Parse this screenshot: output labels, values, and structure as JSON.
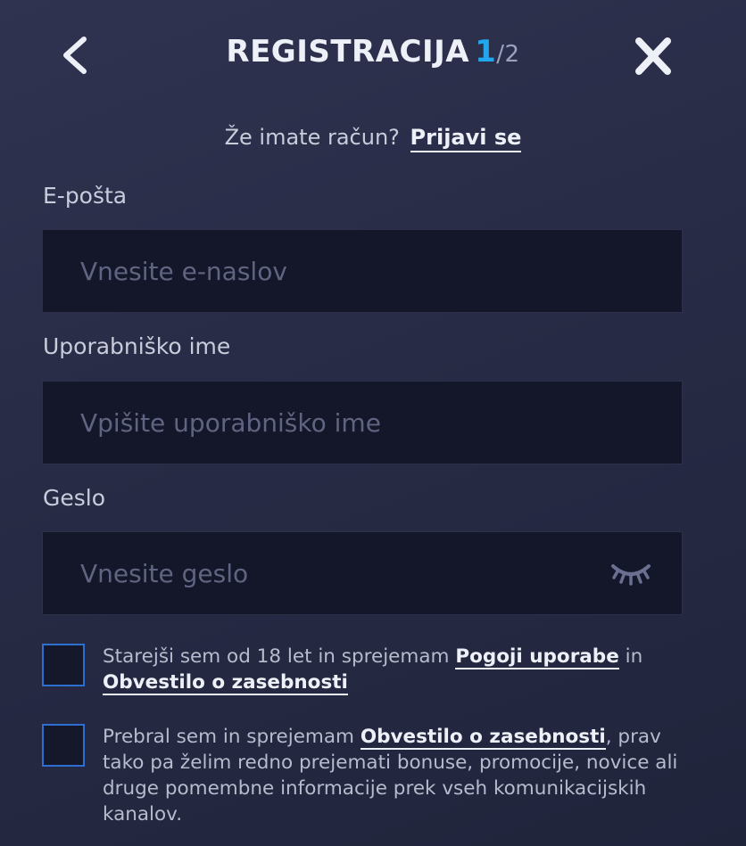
{
  "header": {
    "title": "REGISTRACIJA",
    "step_current": "1",
    "step_separator": "/",
    "step_total": "2",
    "back_icon": "chevron-left-icon",
    "close_icon": "close-icon"
  },
  "login_prompt": {
    "text": "Že imate račun?",
    "link": "Prijavi se"
  },
  "fields": {
    "email": {
      "label": "E-pošta",
      "placeholder": "Vnesite e-naslov",
      "value": ""
    },
    "username": {
      "label": "Uporabniško ime",
      "placeholder": "Vpišite uporabniško ime",
      "value": ""
    },
    "password": {
      "label": "Geslo",
      "placeholder": "Vnesite geslo",
      "value": "",
      "toggle_icon": "eye-closed-icon"
    }
  },
  "consents": {
    "age_terms": {
      "checked": false,
      "text_1": "Starejši sem od 18 let in sprejemam ",
      "link_1": "Pogoji uporabe",
      "text_2": " in ",
      "link_2": "Obvestilo o zasebnosti"
    },
    "marketing": {
      "checked": false,
      "text_1": "Prebral sem in sprejemam ",
      "link_1": "Obvestilo o zasebnosti",
      "text_2": ", prav tako pa želim redno prejemati bonuse, promocije, novice ali druge pomembne informacije prek vseh komunikacijskih kanalov."
    }
  },
  "colors": {
    "background": "#2a2e48",
    "input_background": "#14162a",
    "accent_blue": "#22a7ee",
    "checkbox_border": "#2d6fd0"
  }
}
